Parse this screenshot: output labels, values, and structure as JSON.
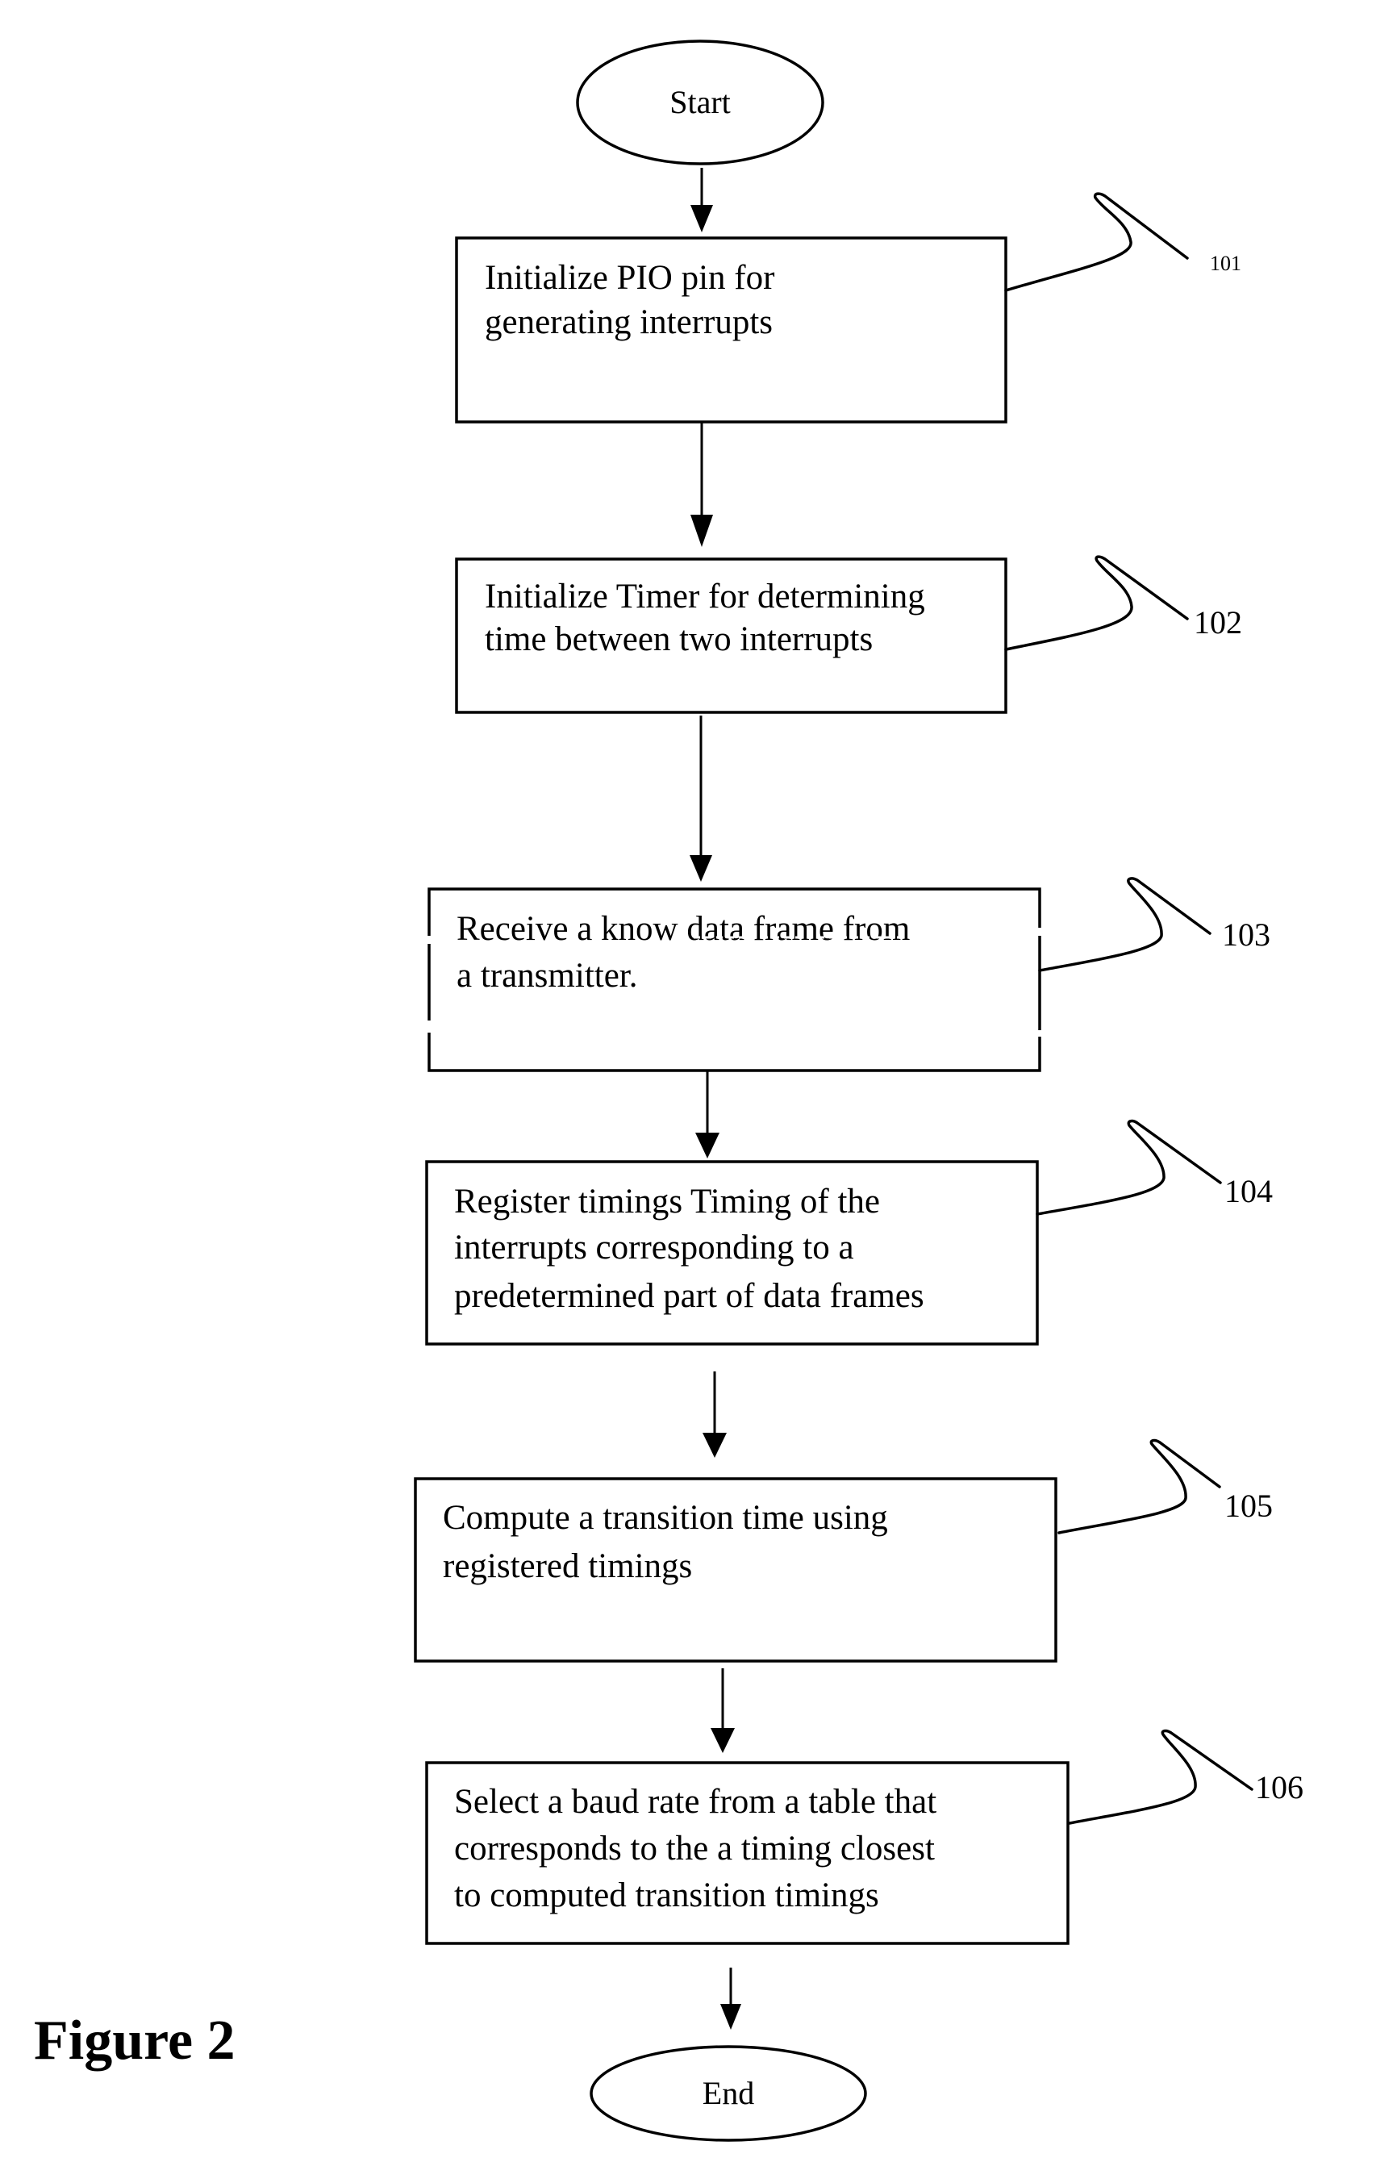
{
  "figure": {
    "caption": "Figure 2",
    "start_label": "Start",
    "end_label": "End",
    "steps": [
      {
        "ref": "101",
        "lines": [
          "Initialize PIO pin for",
          "generating interrupts"
        ]
      },
      {
        "ref": "102",
        "lines": [
          "Initialize Timer for determining",
          "time between two interrupts"
        ]
      },
      {
        "ref": "103",
        "lines": [
          "Receive a know data frame from",
          "a transmitter."
        ]
      },
      {
        "ref": "104",
        "lines": [
          "Register timings Timing of the",
          "interrupts corresponding to a",
          "predetermined part of data frames"
        ]
      },
      {
        "ref": "105",
        "lines": [
          "Compute a transition time using",
          "registered timings"
        ]
      },
      {
        "ref": "106",
        "lines": [
          "Select a baud rate from a table that",
          "corresponds to the a timing closest",
          "to computed transition timings"
        ]
      }
    ]
  }
}
